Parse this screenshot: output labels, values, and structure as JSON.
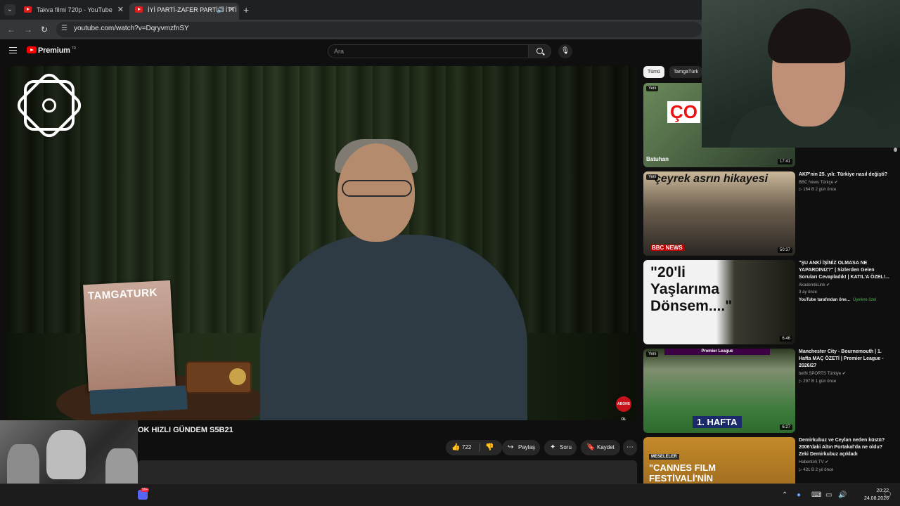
{
  "browser": {
    "tabs": [
      {
        "title": "Takva filmi 720p - YouTube",
        "active": false
      },
      {
        "title": "İYİ PARTİ-ZAFER PARTİSİ İTTİ",
        "active": true
      }
    ],
    "url": "youtube.com/watch?v=DqryvmzfnSY"
  },
  "youtube": {
    "logo": "Premium",
    "region": "TR",
    "search_placeholder": "Ara",
    "video_title": "OK HIZLI GÜNDEM S5B21",
    "likes": "722",
    "actions": {
      "share": "Paylaş",
      "ask": "Soru",
      "save": "Kaydet"
    },
    "player": {
      "magazine_title": "TAMGATURK",
      "subscribe_badge": "ABONE OL"
    },
    "chips": [
      "Tümü",
      "TamgaTürk"
    ]
  },
  "recommendations": [
    {
      "title": "",
      "channel": "",
      "meta": "",
      "duration": "17:41",
      "new": "Yeni",
      "thumb_text": "ÇO",
      "thumb_sub": "Batuhan"
    },
    {
      "title": "AKP'nin 25. yılı: Türkiye nasıl değişti?",
      "channel": "BBC News Türkçe",
      "meta": "▷ 164 B  2 gün önce",
      "duration": "50:37",
      "new": "Yeni",
      "thumb_text": "çeyrek asrın hikayesi",
      "thumb_sub": "BBC NEWS"
    },
    {
      "title": "\"ŞU ANKİ İŞİNİZ OLMASA NE YAPARDINIZ?\" | Sizlerden Gelen Soruları Cevapladık! | KATIL'A ÖZEL!...",
      "channel": "AkademikLink",
      "meta": "3 ay önce",
      "extra": "YouTube tarafından öne...",
      "member": "Üyelere özel",
      "duration": "6:46",
      "new": "",
      "thumb_text": "\"20'li Yaşlarıma Dönsem....\"",
      "thumb_sub": ""
    },
    {
      "title": "Manchester City - Bournemouth | 1. Hafta MAÇ ÖZETİ | Premier League - 2026/27",
      "channel": "beIN SPORTS Türkiye",
      "meta": "▷ 297 B  1 gün önce",
      "duration": "6:27",
      "new": "Yeni",
      "thumb_text": "1. HAFTA",
      "thumb_sub": "Premier League"
    },
    {
      "title": "Demirkubuz ve Ceylan neden küstü? 2006'daki Altın Portakal'da ne oldu? Zeki Demirkubuz açıkladı",
      "channel": "Habertürk TV",
      "meta": "▷ 431 B  2 yıl önce",
      "duration": "",
      "new": "",
      "thumb_text": "\"CANNES FILM FESTİVALİ'NİN",
      "thumb_sub": "MESELELER"
    }
  ],
  "taskbar": {
    "time": "20:22",
    "date": "24.08.2026",
    "badge": "99+"
  },
  "colors": {
    "yt_red": "#ff0000",
    "bg": "#0f0f0f",
    "chip_bg": "#272727"
  }
}
